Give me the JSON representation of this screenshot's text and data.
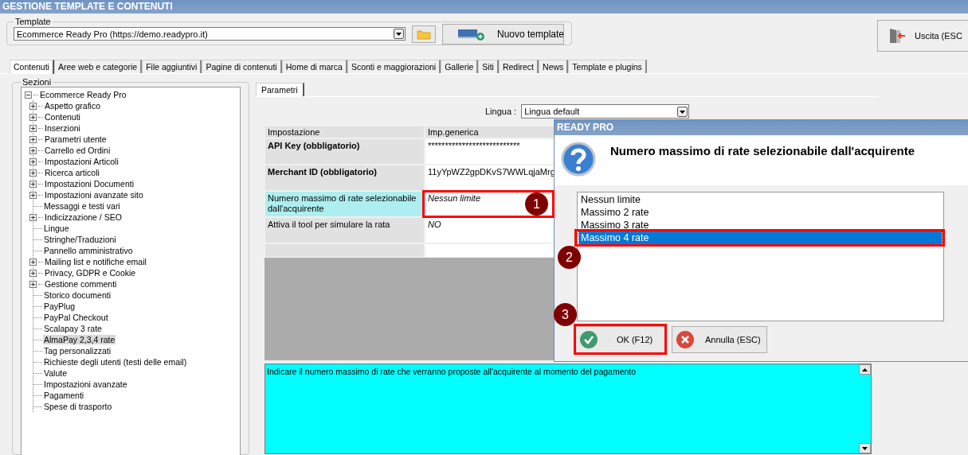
{
  "window": {
    "title": "GESTIONE TEMPLATE E CONTENUTI"
  },
  "template": {
    "label": "Template",
    "value": "Ecommerce Ready Pro (https://demo.readypro.it)"
  },
  "new_template_button": "Nuovo template",
  "exit_button": "Uscita (ESC",
  "tabs": [
    {
      "label": "Contenuti",
      "selected": true
    },
    {
      "label": "Aree web e categorie",
      "selected": false
    },
    {
      "label": "File aggiuntivi",
      "selected": false
    },
    {
      "label": "Pagine di contenuti",
      "selected": false
    },
    {
      "label": "Home di marca",
      "selected": false
    },
    {
      "label": "Sconti e maggiorazioni",
      "selected": false
    },
    {
      "label": "Gallerie",
      "selected": false
    },
    {
      "label": "Siti",
      "selected": false
    },
    {
      "label": "Redirect",
      "selected": false
    },
    {
      "label": "News",
      "selected": false
    },
    {
      "label": "Template e plugins",
      "selected": false
    }
  ],
  "sections": {
    "label": "Sezioni",
    "tree": [
      {
        "label": "Ecommerce Ready Pro",
        "kind": "group",
        "expanded": true,
        "selected": false,
        "children": [
          {
            "label": "Aspetto grafico",
            "kind": "group",
            "expanded": false,
            "selected": false
          },
          {
            "label": "Contenuti",
            "kind": "group",
            "expanded": false,
            "selected": false
          },
          {
            "label": "Inserzioni",
            "kind": "group",
            "expanded": false,
            "selected": false
          },
          {
            "label": "Parametri utente",
            "kind": "group",
            "expanded": false,
            "selected": false
          },
          {
            "label": "Carrello ed Ordini",
            "kind": "group",
            "expanded": false,
            "selected": false
          },
          {
            "label": "Impostazioni Articoli",
            "kind": "group",
            "expanded": false,
            "selected": false
          },
          {
            "label": "Ricerca articoli",
            "kind": "group",
            "expanded": false,
            "selected": false
          },
          {
            "label": "Impostazioni Documenti",
            "kind": "group",
            "expanded": false,
            "selected": false
          },
          {
            "label": "Impostazioni avanzate sito",
            "kind": "group",
            "expanded": false,
            "selected": false
          },
          {
            "label": "Messaggi e testi vari",
            "kind": "leaf",
            "selected": false
          },
          {
            "label": "Indicizzazione / SEO",
            "kind": "group",
            "expanded": false,
            "selected": false
          },
          {
            "label": "Lingue",
            "kind": "leaf",
            "selected": false
          },
          {
            "label": "Stringhe/Traduzioni",
            "kind": "leaf",
            "selected": false
          },
          {
            "label": "Pannello amministrativo",
            "kind": "leaf",
            "selected": false
          },
          {
            "label": "Mailing list e notifiche email",
            "kind": "group",
            "expanded": false,
            "selected": false
          },
          {
            "label": "Privacy, GDPR e Cookie",
            "kind": "group",
            "expanded": false,
            "selected": false
          },
          {
            "label": "Gestione commenti",
            "kind": "group",
            "expanded": false,
            "selected": false
          },
          {
            "label": "Storico documenti",
            "kind": "leaf",
            "selected": false
          },
          {
            "label": "PayPlug",
            "kind": "leaf",
            "selected": false
          },
          {
            "label": "PayPal Checkout",
            "kind": "leaf",
            "selected": false
          },
          {
            "label": "Scalapay 3 rate",
            "kind": "leaf",
            "selected": false
          },
          {
            "label": "AlmaPay 2,3,4 rate",
            "kind": "leaf",
            "selected": true
          },
          {
            "label": "Tag personalizzati",
            "kind": "leaf",
            "selected": false
          },
          {
            "label": "Richieste degli utenti (testi delle email)",
            "kind": "leaf",
            "selected": false
          },
          {
            "label": "Valute",
            "kind": "leaf",
            "selected": false
          },
          {
            "label": "Impostazioni avanzate",
            "kind": "leaf",
            "selected": false
          },
          {
            "label": "Pagamenti",
            "kind": "leaf",
            "selected": false
          },
          {
            "label": "Spese di trasporto",
            "kind": "leaf",
            "selected": false
          }
        ]
      }
    ]
  },
  "subtabs": [
    {
      "label": "Parametri",
      "selected": true
    }
  ],
  "language": {
    "label": "Lingua :",
    "value": "Lingua default"
  },
  "settings_table": {
    "columns": [
      "Impostazione",
      "Imp.generica"
    ],
    "rows": [
      {
        "name": "API Key (obbligatorio)",
        "value": "***************************",
        "bold": true,
        "italic": false,
        "selected": false
      },
      {
        "name": "Merchant ID (obbligatorio)",
        "value": "11yYpWZ2gpDKvS7WWLqjaMrg",
        "bold": true,
        "italic": false,
        "selected": false
      },
      {
        "name": "Numero massimo di rate selezionabile dall'acquirente",
        "value": "Nessun limite",
        "bold": false,
        "italic": true,
        "selected": true,
        "callout": "1"
      },
      {
        "name": "Attiva il tool per simulare la rata",
        "value": "NO",
        "bold": false,
        "italic": true,
        "selected": false
      }
    ]
  },
  "description": "Indicare il numero massimo di rate che verranno proposte all'acquirente al momento del pagamento",
  "dialog": {
    "title": "READY PRO",
    "question": "Numero massimo di rate selezionabile dall'acquirente",
    "options": [
      {
        "label": "Nessun limite",
        "selected": false
      },
      {
        "label": "Massimo 2 rate",
        "selected": false
      },
      {
        "label": "Massimo 3 rate",
        "selected": false
      },
      {
        "label": "Massimo 4 rate",
        "selected": true,
        "callout": "2"
      }
    ],
    "buttons": [
      {
        "label": "OK (F12)",
        "kind": "ok",
        "callout": "3"
      },
      {
        "label": "Annulla (ESC)",
        "kind": "cancel"
      }
    ]
  }
}
